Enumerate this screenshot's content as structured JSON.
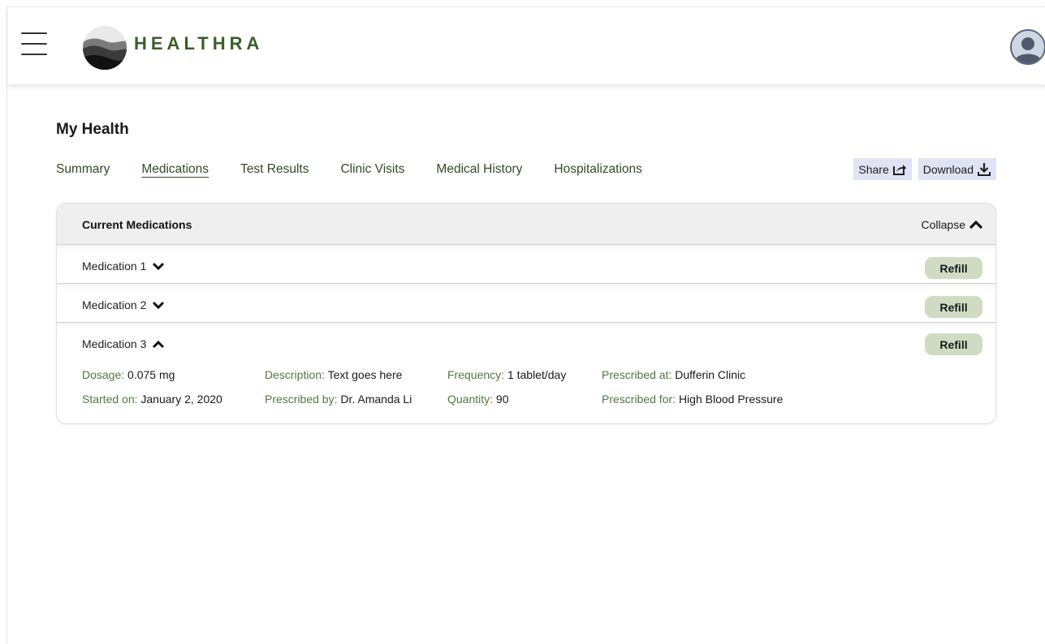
{
  "app": {
    "logo_text": "HEALTHRA"
  },
  "page": {
    "title": "My Health"
  },
  "tabs": [
    {
      "label": "Summary",
      "active": false
    },
    {
      "label": "Medications",
      "active": true
    },
    {
      "label": "Test Results",
      "active": false
    },
    {
      "label": "Clinic Visits",
      "active": false
    },
    {
      "label": "Medical History",
      "active": false
    },
    {
      "label": "Hospitalizations",
      "active": false
    }
  ],
  "actions": {
    "share_label": "Share",
    "download_label": "Download"
  },
  "card": {
    "title": "Current Medications",
    "collapse_label": "Collapse"
  },
  "medications": [
    {
      "name": "Medication 1",
      "expanded": false,
      "refill_label": "Refill"
    },
    {
      "name": "Medication 2",
      "expanded": false,
      "refill_label": "Refill"
    },
    {
      "name": "Medication 3",
      "expanded": true,
      "refill_label": "Refill"
    }
  ],
  "details": {
    "dosage_label": "Dosage:",
    "dosage_value": "0.075 mg",
    "started_label": "Started on:",
    "started_value": "January 2, 2020",
    "description_label": "Description:",
    "description_value": "Text goes here",
    "prescribed_by_label": "Prescribed by:",
    "prescribed_by_value": "Dr. Amanda Li",
    "frequency_label": "Frequency:",
    "frequency_value": "1 tablet/day",
    "quantity_label": "Quantity:",
    "quantity_value": "90",
    "prescribed_at_label": "Prescribed at:",
    "prescribed_at_value": "Dufferin Clinic",
    "prescribed_for_label": "Prescribed for:",
    "prescribed_for_value": "High Blood Pressure"
  },
  "colors": {
    "brand_green": "#3b5e2a",
    "label_green": "#4f7a3c",
    "refill_bg": "#cfdcc3",
    "action_bg": "#dfe3f3"
  },
  "icons": [
    "hamburger-menu-icon",
    "logo-icon",
    "user-avatar-icon",
    "share-icon",
    "download-icon",
    "chevron-up-icon",
    "chevron-down-icon"
  ]
}
